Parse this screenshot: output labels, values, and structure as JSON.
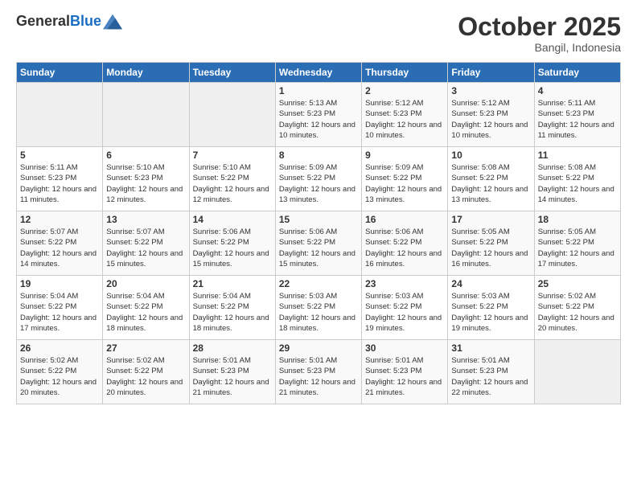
{
  "logo": {
    "general": "General",
    "blue": "Blue"
  },
  "header": {
    "month": "October 2025",
    "location": "Bangil, Indonesia"
  },
  "weekdays": [
    "Sunday",
    "Monday",
    "Tuesday",
    "Wednesday",
    "Thursday",
    "Friday",
    "Saturday"
  ],
  "weeks": [
    [
      {
        "day": "",
        "sunrise": "",
        "sunset": "",
        "daylight": ""
      },
      {
        "day": "",
        "sunrise": "",
        "sunset": "",
        "daylight": ""
      },
      {
        "day": "",
        "sunrise": "",
        "sunset": "",
        "daylight": ""
      },
      {
        "day": "1",
        "sunrise": "Sunrise: 5:13 AM",
        "sunset": "Sunset: 5:23 PM",
        "daylight": "Daylight: 12 hours and 10 minutes."
      },
      {
        "day": "2",
        "sunrise": "Sunrise: 5:12 AM",
        "sunset": "Sunset: 5:23 PM",
        "daylight": "Daylight: 12 hours and 10 minutes."
      },
      {
        "day": "3",
        "sunrise": "Sunrise: 5:12 AM",
        "sunset": "Sunset: 5:23 PM",
        "daylight": "Daylight: 12 hours and 10 minutes."
      },
      {
        "day": "4",
        "sunrise": "Sunrise: 5:11 AM",
        "sunset": "Sunset: 5:23 PM",
        "daylight": "Daylight: 12 hours and 11 minutes."
      }
    ],
    [
      {
        "day": "5",
        "sunrise": "Sunrise: 5:11 AM",
        "sunset": "Sunset: 5:23 PM",
        "daylight": "Daylight: 12 hours and 11 minutes."
      },
      {
        "day": "6",
        "sunrise": "Sunrise: 5:10 AM",
        "sunset": "Sunset: 5:23 PM",
        "daylight": "Daylight: 12 hours and 12 minutes."
      },
      {
        "day": "7",
        "sunrise": "Sunrise: 5:10 AM",
        "sunset": "Sunset: 5:22 PM",
        "daylight": "Daylight: 12 hours and 12 minutes."
      },
      {
        "day": "8",
        "sunrise": "Sunrise: 5:09 AM",
        "sunset": "Sunset: 5:22 PM",
        "daylight": "Daylight: 12 hours and 13 minutes."
      },
      {
        "day": "9",
        "sunrise": "Sunrise: 5:09 AM",
        "sunset": "Sunset: 5:22 PM",
        "daylight": "Daylight: 12 hours and 13 minutes."
      },
      {
        "day": "10",
        "sunrise": "Sunrise: 5:08 AM",
        "sunset": "Sunset: 5:22 PM",
        "daylight": "Daylight: 12 hours and 13 minutes."
      },
      {
        "day": "11",
        "sunrise": "Sunrise: 5:08 AM",
        "sunset": "Sunset: 5:22 PM",
        "daylight": "Daylight: 12 hours and 14 minutes."
      }
    ],
    [
      {
        "day": "12",
        "sunrise": "Sunrise: 5:07 AM",
        "sunset": "Sunset: 5:22 PM",
        "daylight": "Daylight: 12 hours and 14 minutes."
      },
      {
        "day": "13",
        "sunrise": "Sunrise: 5:07 AM",
        "sunset": "Sunset: 5:22 PM",
        "daylight": "Daylight: 12 hours and 15 minutes."
      },
      {
        "day": "14",
        "sunrise": "Sunrise: 5:06 AM",
        "sunset": "Sunset: 5:22 PM",
        "daylight": "Daylight: 12 hours and 15 minutes."
      },
      {
        "day": "15",
        "sunrise": "Sunrise: 5:06 AM",
        "sunset": "Sunset: 5:22 PM",
        "daylight": "Daylight: 12 hours and 15 minutes."
      },
      {
        "day": "16",
        "sunrise": "Sunrise: 5:06 AM",
        "sunset": "Sunset: 5:22 PM",
        "daylight": "Daylight: 12 hours and 16 minutes."
      },
      {
        "day": "17",
        "sunrise": "Sunrise: 5:05 AM",
        "sunset": "Sunset: 5:22 PM",
        "daylight": "Daylight: 12 hours and 16 minutes."
      },
      {
        "day": "18",
        "sunrise": "Sunrise: 5:05 AM",
        "sunset": "Sunset: 5:22 PM",
        "daylight": "Daylight: 12 hours and 17 minutes."
      }
    ],
    [
      {
        "day": "19",
        "sunrise": "Sunrise: 5:04 AM",
        "sunset": "Sunset: 5:22 PM",
        "daylight": "Daylight: 12 hours and 17 minutes."
      },
      {
        "day": "20",
        "sunrise": "Sunrise: 5:04 AM",
        "sunset": "Sunset: 5:22 PM",
        "daylight": "Daylight: 12 hours and 18 minutes."
      },
      {
        "day": "21",
        "sunrise": "Sunrise: 5:04 AM",
        "sunset": "Sunset: 5:22 PM",
        "daylight": "Daylight: 12 hours and 18 minutes."
      },
      {
        "day": "22",
        "sunrise": "Sunrise: 5:03 AM",
        "sunset": "Sunset: 5:22 PM",
        "daylight": "Daylight: 12 hours and 18 minutes."
      },
      {
        "day": "23",
        "sunrise": "Sunrise: 5:03 AM",
        "sunset": "Sunset: 5:22 PM",
        "daylight": "Daylight: 12 hours and 19 minutes."
      },
      {
        "day": "24",
        "sunrise": "Sunrise: 5:03 AM",
        "sunset": "Sunset: 5:22 PM",
        "daylight": "Daylight: 12 hours and 19 minutes."
      },
      {
        "day": "25",
        "sunrise": "Sunrise: 5:02 AM",
        "sunset": "Sunset: 5:22 PM",
        "daylight": "Daylight: 12 hours and 20 minutes."
      }
    ],
    [
      {
        "day": "26",
        "sunrise": "Sunrise: 5:02 AM",
        "sunset": "Sunset: 5:22 PM",
        "daylight": "Daylight: 12 hours and 20 minutes."
      },
      {
        "day": "27",
        "sunrise": "Sunrise: 5:02 AM",
        "sunset": "Sunset: 5:22 PM",
        "daylight": "Daylight: 12 hours and 20 minutes."
      },
      {
        "day": "28",
        "sunrise": "Sunrise: 5:01 AM",
        "sunset": "Sunset: 5:23 PM",
        "daylight": "Daylight: 12 hours and 21 minutes."
      },
      {
        "day": "29",
        "sunrise": "Sunrise: 5:01 AM",
        "sunset": "Sunset: 5:23 PM",
        "daylight": "Daylight: 12 hours and 21 minutes."
      },
      {
        "day": "30",
        "sunrise": "Sunrise: 5:01 AM",
        "sunset": "Sunset: 5:23 PM",
        "daylight": "Daylight: 12 hours and 21 minutes."
      },
      {
        "day": "31",
        "sunrise": "Sunrise: 5:01 AM",
        "sunset": "Sunset: 5:23 PM",
        "daylight": "Daylight: 12 hours and 22 minutes."
      },
      {
        "day": "",
        "sunrise": "",
        "sunset": "",
        "daylight": ""
      }
    ]
  ]
}
